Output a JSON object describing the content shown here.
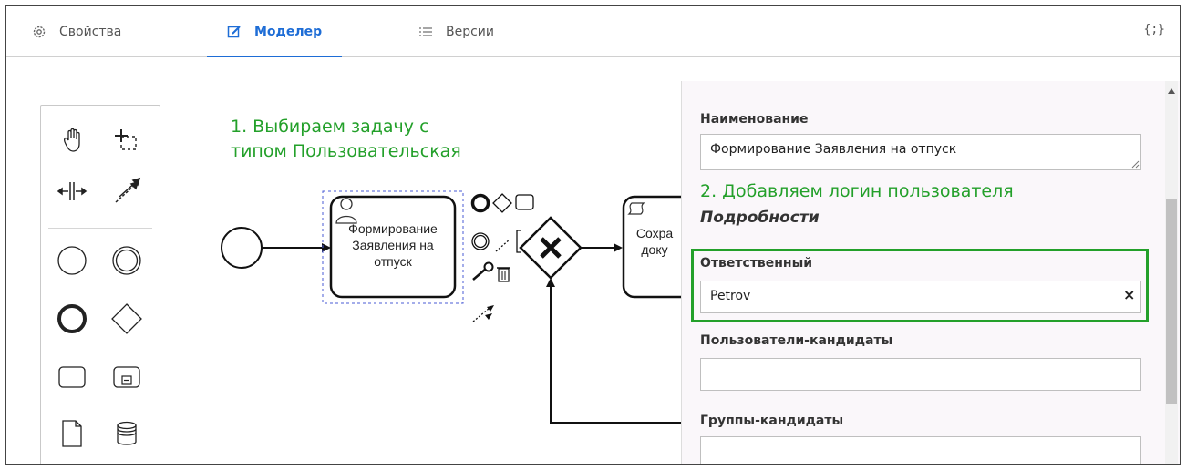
{
  "tabs": [
    {
      "label": "Свойства",
      "icon": "gear-icon"
    },
    {
      "label": "Моделер",
      "icon": "edit-icon",
      "active": true
    },
    {
      "label": "Версии",
      "icon": "list-icon"
    }
  ],
  "json_button": "{;}",
  "annotations": {
    "step1_line1": "1. Выбираем задачу с",
    "step1_line2": "типом Пользовательская",
    "step2": "2. Добавляем логин пользователя"
  },
  "diagram": {
    "task1_line1": "Формирование",
    "task1_line2": "Заявления на",
    "task1_line3": "отпуск",
    "task2_line1": "Сохра",
    "task2_line2": "доку"
  },
  "properties": {
    "name_label": "Наименование",
    "name_value": "Формирование Заявления на отпуск",
    "details_title": "Подробности",
    "assignee_label": "Ответственный",
    "assignee_value": "Petrov",
    "clear_symbol": "×",
    "candidate_users_label": "Пользователи-кандидаты",
    "candidate_users_value": "",
    "candidate_groups_label": "Группы-кандидаты",
    "candidate_groups_value": ""
  },
  "colors": {
    "accent": "#1e6dd6",
    "annotation": "#23a02a"
  }
}
